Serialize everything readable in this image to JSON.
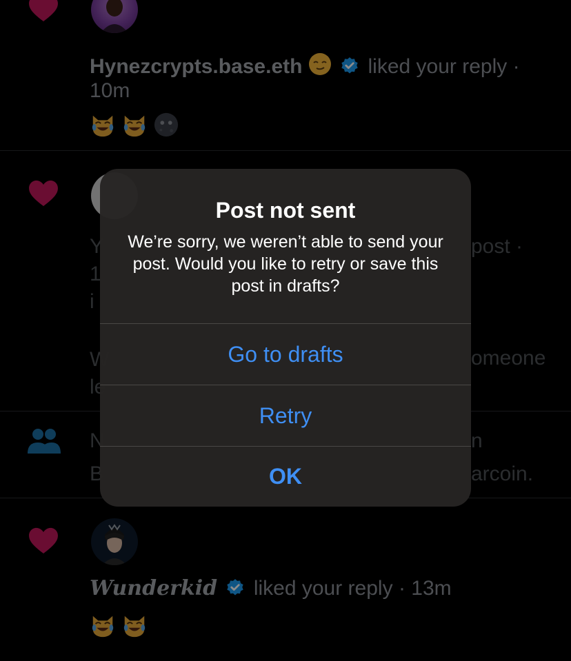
{
  "feed": {
    "items": [
      {
        "user": "Hynezcrypts.base.eth",
        "name_emoji": "smiling-face-icon",
        "verified": true,
        "action": "liked your reply ·",
        "time": "10m",
        "reply_emojis": [
          "cat-tears-icon",
          "cat-tears-icon",
          "new-moon-face-icon"
        ]
      },
      {
        "covered_left": [
          "Y",
          "1",
          "i",
          "W",
          "le"
        ],
        "covered_right": [
          "post ·",
          "omeone"
        ]
      },
      {
        "covered_left": [
          "N",
          "B"
        ],
        "covered_right": [
          "n",
          "arcoin."
        ]
      },
      {
        "user": "Wunderkid",
        "verified": true,
        "action": "liked your reply",
        "time": "· 13m",
        "reply_emojis": [
          "cat-tears-icon",
          "cat-tears-icon"
        ]
      }
    ]
  },
  "alert": {
    "title": "Post not sent",
    "message": "We’re sorry, we weren’t able to send your post. Would you like to retry or save this post in drafts?",
    "buttons": [
      "Go to drafts",
      "Retry",
      "OK"
    ]
  },
  "colors": {
    "heart": "#c2185b",
    "verified": "#1d9bf0",
    "alert_button": "#3f8ff4",
    "people_icon": "#1d6fa5"
  }
}
